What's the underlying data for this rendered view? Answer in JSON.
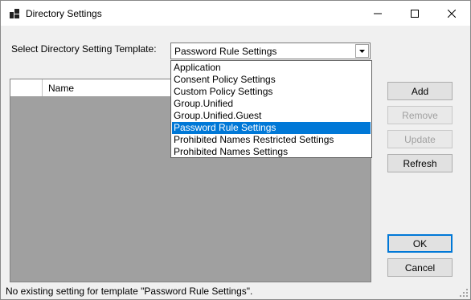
{
  "window": {
    "title": "Directory Settings",
    "minimize_icon": "minimize-icon",
    "maximize_icon": "maximize-icon",
    "close_icon": "close-icon"
  },
  "template_selector": {
    "label": "Select Directory Setting Template:",
    "selected_value": "Password Rule Settings",
    "arrow_icon": "chevron-down-icon",
    "options": [
      "Application",
      "Consent Policy Settings",
      "Custom Policy Settings",
      "Group.Unified",
      "Group.Unified.Guest",
      "Password Rule Settings",
      "Prohibited Names Restricted Settings",
      "Prohibited Names Settings"
    ],
    "highlighted_index": 5
  },
  "grid": {
    "columns": [
      "Name"
    ]
  },
  "buttons": {
    "add": "Add",
    "remove": "Remove",
    "update": "Update",
    "refresh": "Refresh",
    "ok": "OK",
    "cancel": "Cancel"
  },
  "status": {
    "message": "No existing setting for template \"Password Rule Settings\"."
  },
  "colors": {
    "selection": "#0078d7",
    "grid_background": "#a0a0a0",
    "window_background": "#f0f0f0"
  }
}
